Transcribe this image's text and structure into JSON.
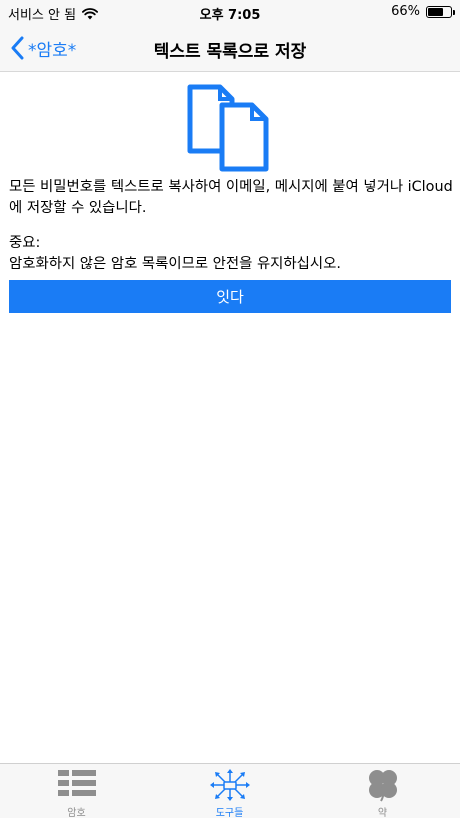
{
  "status_bar": {
    "carrier": "서비스 안 됨",
    "time": "오후 7:05",
    "battery_percent": "66%",
    "battery_level": 0.66
  },
  "nav": {
    "back_label": "*암호*",
    "title": "텍스트 목록으로 저장"
  },
  "main": {
    "description": "모든 비밀번호를 텍스트로 복사하여 이메일, 메시지에 붙여 넣거나 iCloud에 저장할 수 있습니다.",
    "important_title": "중요:",
    "important_text": "암호화하지 않은 암호 목록이므로 안전을 유지하십시오.",
    "button_label": "잇다"
  },
  "tabs": [
    {
      "label": "암호",
      "icon": "list-icon",
      "active": false
    },
    {
      "label": "도구들",
      "icon": "network-icon",
      "active": true
    },
    {
      "label": "약",
      "icon": "clover-icon",
      "active": false
    }
  ],
  "colors": {
    "accent": "#1a7cf5",
    "inactive_tab": "#8e8e8e"
  }
}
